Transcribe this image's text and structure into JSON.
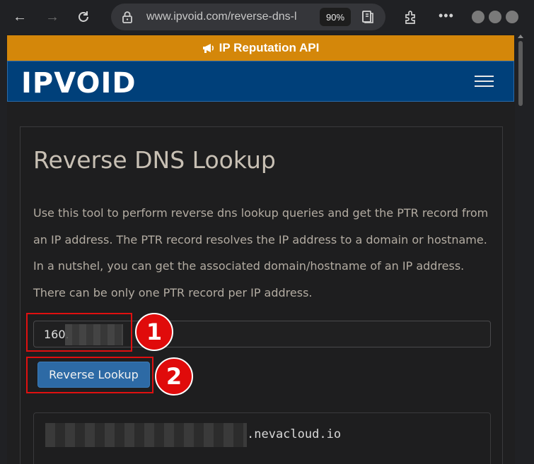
{
  "browser": {
    "url": "www.ipvoid.com/reverse-dns-l",
    "zoom": "90%"
  },
  "promo": {
    "label": "IP Reputation API"
  },
  "header": {
    "logo": "IPVOID"
  },
  "main": {
    "title": "Reverse DNS Lookup",
    "description": "Use this tool to perform reverse dns lookup queries and get the PTR record from an IP address. The PTR record resolves the IP address to a domain or hostname. In a nutshel, you can get the associated domain/hostname of an IP address. There can be only one PTR record per IP address.",
    "ip_value": "160.",
    "button_label": "Reverse Lookup",
    "result_suffix": ".nevacloud.io"
  },
  "annotations": {
    "step1": "1",
    "step2": "2"
  },
  "colors": {
    "accent": "#2d6aa5",
    "promo": "#d4870a",
    "header": "#00407a",
    "marker": "#e00b0b"
  }
}
